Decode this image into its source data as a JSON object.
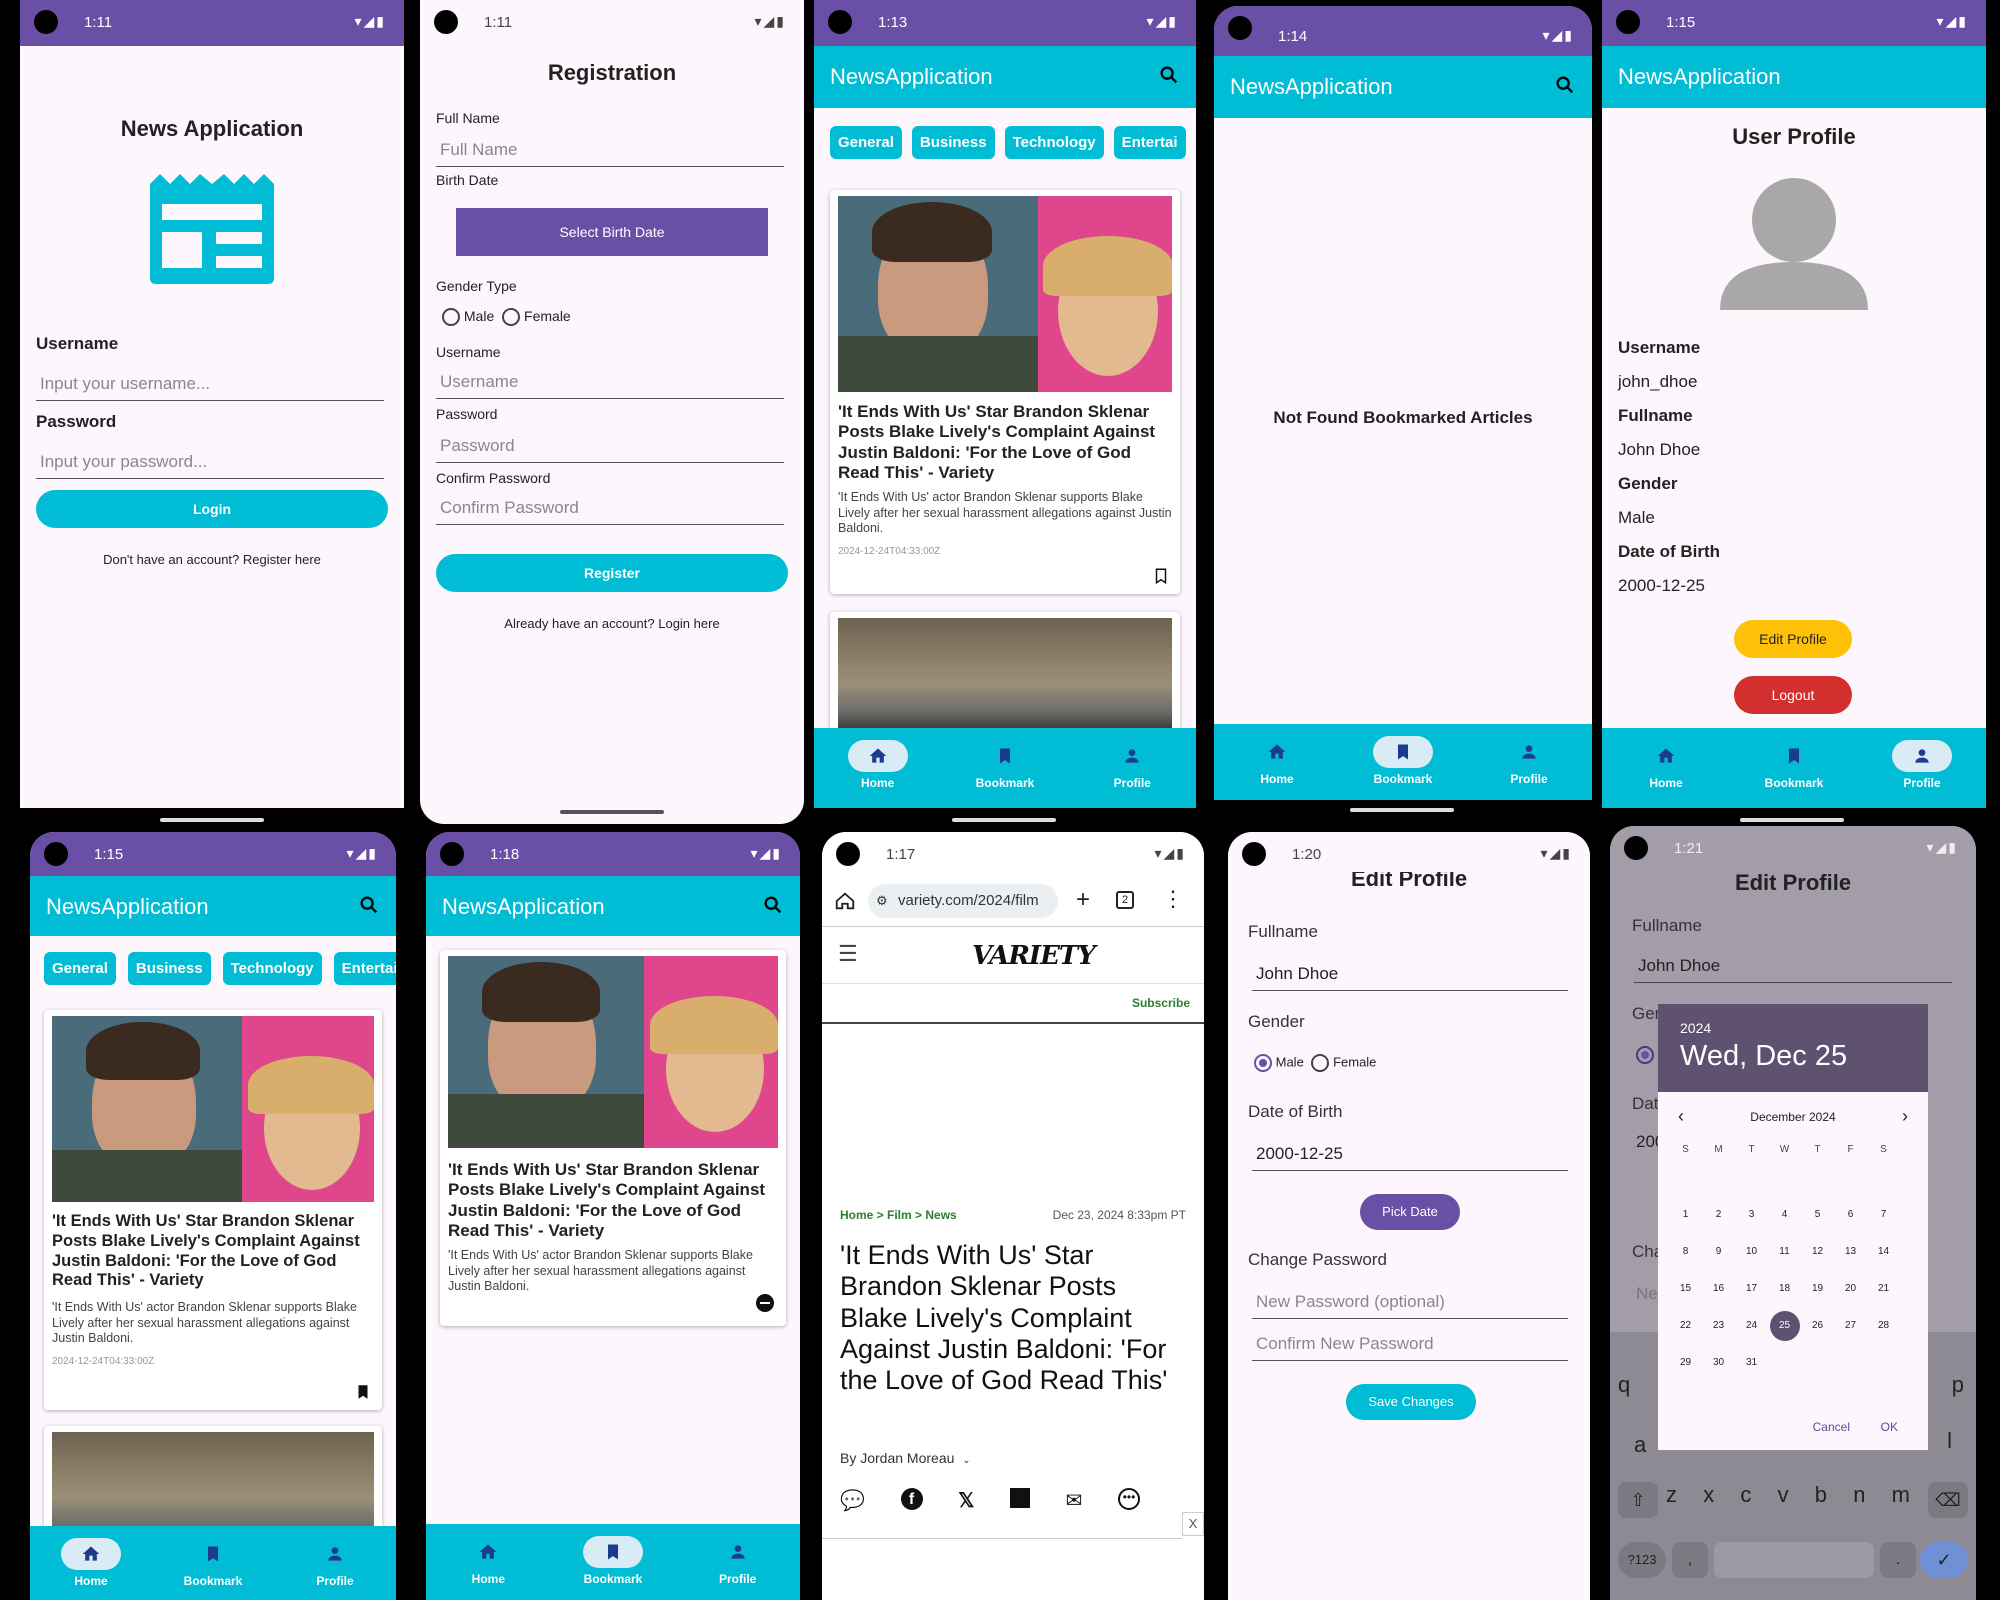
{
  "screens": {
    "s1": {
      "status_time": "1:11",
      "title": "News Application",
      "username_label": "Username",
      "username_placeholder": "Input your username...",
      "password_label": "Password",
      "password_placeholder": "Input your password...",
      "login_button": "Login",
      "register_link": "Don't have an account? Register here"
    },
    "s2": {
      "status_time": "1:11",
      "title": "Registration",
      "fullname_label": "Full Name",
      "fullname_placeholder": "Full Name",
      "birthdate_label": "Birth Date",
      "select_birthdate_button": "Select Birth Date",
      "gender_label": "Gender Type",
      "gender_male": "Male",
      "gender_female": "Female",
      "username_label": "Username",
      "username_placeholder": "Username",
      "password_label": "Password",
      "password_placeholder": "Password",
      "confirm_label": "Confirm Password",
      "confirm_placeholder": "Confirm Password",
      "register_button": "Register",
      "login_link": "Already have an account? Login here"
    },
    "s3": {
      "status_time": "1:13",
      "app_title": "NewsApplication",
      "categories": [
        "General",
        "Business",
        "Technology",
        "Entertai"
      ],
      "article_title": "'It Ends With Us' Star Brandon Sklenar Posts Blake Lively's Complaint Against Justin Baldoni: 'For the Love of God Read This' - Variety",
      "article_desc": "'It Ends With Us' actor Brandon Sklenar supports Blake Lively after her sexual harassment allegations against Justin Baldoni.",
      "article_date": "2024-12-24T04:33:00Z"
    },
    "s4": {
      "status_time": "1:14",
      "app_title": "NewsApplication",
      "empty_message": "Not Found Bookmarked Articles"
    },
    "s5": {
      "status_time": "1:15",
      "app_title": "NewsApplication",
      "title": "User Profile",
      "username_label": "Username",
      "username_value": "john_dhoe",
      "fullname_label": "Fullname",
      "fullname_value": "John Dhoe",
      "gender_label": "Gender",
      "gender_value": "Male",
      "dob_label": "Date of Birth",
      "dob_value": "2000-12-25",
      "edit_button": "Edit Profile",
      "logout_button": "Logout"
    },
    "s6": {
      "status_time": "1:15",
      "app_title": "NewsApplication",
      "categories": [
        "General",
        "Business",
        "Technology",
        "Entertai"
      ],
      "article_title": "'It Ends With Us' Star Brandon Sklenar Posts Blake Lively's Complaint Against Justin Baldoni: 'For the Love of God Read This' - Variety",
      "article_desc": "'It Ends With Us' actor Brandon Sklenar supports Blake Lively after her sexual harassment allegations against Justin Baldoni.",
      "article_date": "2024-12-24T04:33:00Z"
    },
    "s7": {
      "status_time": "1:18",
      "app_title": "NewsApplication",
      "article_title": "'It Ends With Us' Star Brandon Sklenar Posts Blake Lively's Complaint Against Justin Baldoni: 'For the Love of God Read This' - Variety",
      "article_desc": "'It Ends With Us' actor Brandon Sklenar supports Blake Lively after her sexual harassment allegations against Justin Baldoni."
    },
    "s8": {
      "status_time": "1:17",
      "url": "variety.com/2024/film",
      "tab_count": "2",
      "logo": "VARIETY",
      "subscribe": "Subscribe",
      "breadcrumb": "Home > Film > News",
      "date": "Dec 23, 2024 8:33pm PT",
      "headline": "'It Ends With Us' Star Brandon Sklenar Posts Blake Lively's Complaint Against Justin Baldoni: 'For the Love of God Read This'",
      "byline": "By Jordan Moreau",
      "close_x": "X"
    },
    "s9": {
      "status_time": "1:20",
      "title": "Edit Profile",
      "fullname_label": "Fullname",
      "fullname_value": "John Dhoe",
      "gender_label": "Gender",
      "gender_male": "Male",
      "gender_female": "Female",
      "dob_label": "Date of Birth",
      "dob_value": "2000-12-25",
      "pick_date_button": "Pick Date",
      "change_pw_label": "Change Password",
      "new_pw_placeholder": "New Password (optional)",
      "confirm_pw_placeholder": "Confirm New Password",
      "save_button": "Save Changes"
    },
    "s10": {
      "status_time": "1:21",
      "title": "Edit Profile",
      "fullname_label": "Fullname",
      "fullname_value": "John Dhoe",
      "gender_label_partial": "Ger",
      "dob_label_partial": "Dat",
      "dob_value_partial": "200",
      "change_pw_partial": "Cha",
      "new_pw_partial": "Ne",
      "picker_year": "2024",
      "picker_date": "Wed, Dec 25",
      "picker_month": "December 2024",
      "weekdays": [
        "S",
        "M",
        "T",
        "W",
        "T",
        "F",
        "S"
      ],
      "days": [
        "",
        "",
        "",
        "",
        "",
        "",
        "",
        "1",
        "2",
        "3",
        "4",
        "5",
        "6",
        "7",
        "8",
        "9",
        "10",
        "11",
        "12",
        "13",
        "14",
        "15",
        "16",
        "17",
        "18",
        "19",
        "20",
        "21",
        "22",
        "23",
        "24",
        "25",
        "26",
        "27",
        "28",
        "29",
        "30",
        "31"
      ],
      "selected_day": "25",
      "cancel": "Cancel",
      "ok": "OK",
      "kb_row1": [
        "q",
        "p"
      ],
      "kb_row2": [
        "a",
        "l"
      ],
      "kb_row3": [
        "z",
        "x",
        "c",
        "v",
        "b",
        "n",
        "m"
      ],
      "kb_mode": "?123",
      "kb_comma": ",",
      "kb_period": "."
    }
  },
  "nav": {
    "home": "Home",
    "bookmark": "Bookmark",
    "profile": "Profile"
  },
  "colors": {
    "status_purple": "#6a4fa6",
    "accent_cyan": "#00bcd4",
    "edit_yellow": "#ffc107",
    "logout_red": "#d32f2f"
  }
}
